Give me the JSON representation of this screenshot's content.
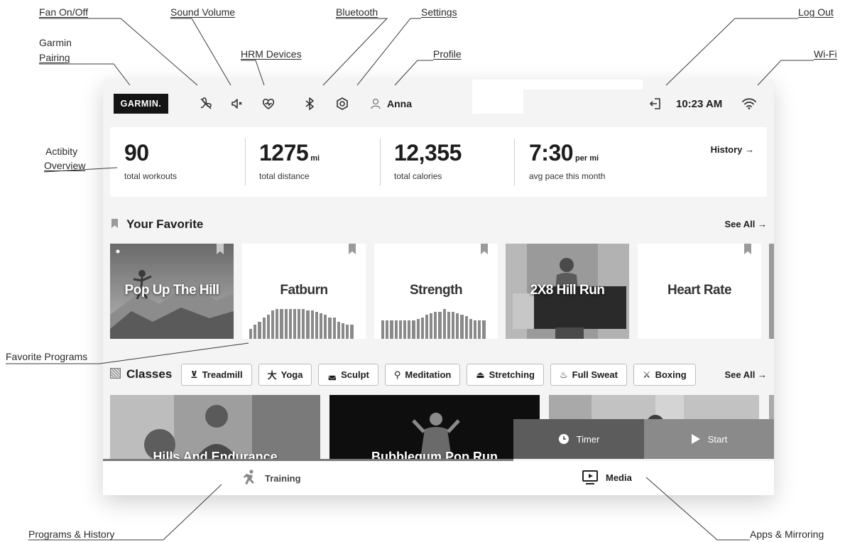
{
  "callouts": {
    "fan": "Fan On/Off",
    "sound": "Sound Volume",
    "garmin_pairing_1": "Garmin",
    "garmin_pairing_2": "Pairing",
    "hrm": "HRM Devices",
    "bluetooth": "Bluetooth",
    "settings": "Settings",
    "profile": "Profile",
    "logout": "Log Out",
    "wifi": "Wi-Fi",
    "activity_1": "Actibity",
    "activity_2": "Overview",
    "favorites": "Favorite Programs",
    "programs_history": "Programs & History",
    "apps_mirroring": "Apps & Mirroring"
  },
  "topbar": {
    "logo": "GARMIN.",
    "profile_name": "Anna",
    "time": "10:23 AM"
  },
  "stats": [
    {
      "value": "90",
      "unit": "",
      "caption": "total workouts"
    },
    {
      "value": "1275",
      "unit": "mi",
      "caption": "total distance"
    },
    {
      "value": "12,355",
      "unit": "",
      "caption": "total calories"
    },
    {
      "value": "7:30",
      "unit": "per mi",
      "caption": "avg pace this month"
    }
  ],
  "history_link": "History →",
  "favorites": {
    "title": "Your Favorite",
    "see_all": "See All →",
    "cards": [
      {
        "title": "Pop Up The Hill"
      },
      {
        "title": "Fatburn"
      },
      {
        "title": "Strength"
      },
      {
        "title": "2X8 Hill Run"
      },
      {
        "title": "Heart Rate"
      }
    ]
  },
  "classes": {
    "title": "Classes",
    "see_all": "See All →",
    "chips": [
      "Treadmill",
      "Yoga",
      "Sculpt",
      "Meditation",
      "Stretching",
      "Full Sweat",
      "Boxing"
    ],
    "cards": [
      {
        "title": "Hills And Endurance"
      },
      {
        "title": "Bubblegum Pop Run"
      }
    ]
  },
  "overlay": {
    "timer": "Timer",
    "start": "Start"
  },
  "bottom_nav": {
    "training": "Training",
    "media": "Media"
  },
  "icons": [
    "fan-icon",
    "speaker-icon",
    "heart-icon",
    "bluetooth-icon",
    "settings-icon",
    "user-icon",
    "logout-icon",
    "wifi-icon",
    "bookmark-icon",
    "grid-icon",
    "clock-icon",
    "play-icon",
    "runner-icon",
    "media-icon"
  ]
}
